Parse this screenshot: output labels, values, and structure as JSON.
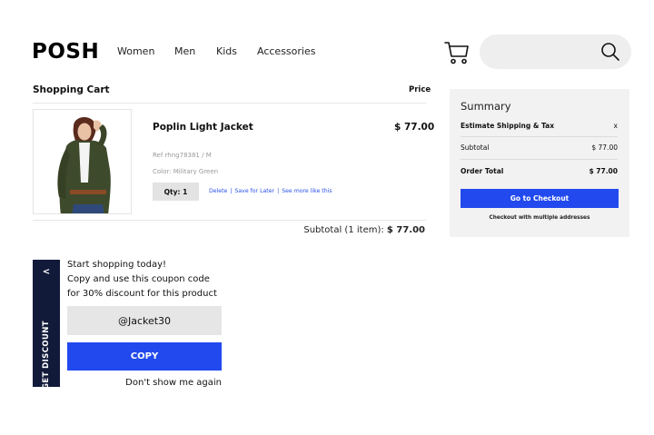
{
  "header": {
    "logo": "POSH",
    "nav": [
      "Women",
      "Men",
      "Kids",
      "Accessories"
    ],
    "icons": {
      "cart": "cart-icon",
      "search": "search-icon"
    }
  },
  "cart": {
    "title": "Shopping Cart",
    "price_header": "Price",
    "item": {
      "name": "Poplin Light Jacket",
      "price": "$ 77.00",
      "ref": "Ref rhng78381 / M",
      "color": "Color: Military Green",
      "qty": "Qty: 1",
      "links": [
        "Delete",
        "Save for Later",
        "See more like this"
      ],
      "link_separator": "|"
    },
    "subtotal_label": "Subtotal (1 item):",
    "subtotal_value": "$ 77.00"
  },
  "summary": {
    "title": "Summary",
    "shipping_label": "Estimate Shipping & Tax",
    "shipping_toggle": "x",
    "subtotal_label": "Subtotal",
    "subtotal_value": "$ 77.00",
    "total_label": "Order Total",
    "total_value": "$ 77.00",
    "checkout_button": "Go to Checkout",
    "multi_address": "Checkout with multiple addresses"
  },
  "discount": {
    "tab_chevron": "<",
    "tab_label": "GET DISCOUNT",
    "lines": [
      "Start shopping today!",
      "Copy and use this coupon code",
      "for 30% discount for this product"
    ],
    "code": "@Jacket30",
    "copy_button": "COPY",
    "dismiss": "Don't show me again"
  },
  "colors": {
    "accent": "#2249ee",
    "tab_bg": "#121a3a",
    "link": "#2a52e8",
    "panel_bg": "#f2f2f2"
  }
}
